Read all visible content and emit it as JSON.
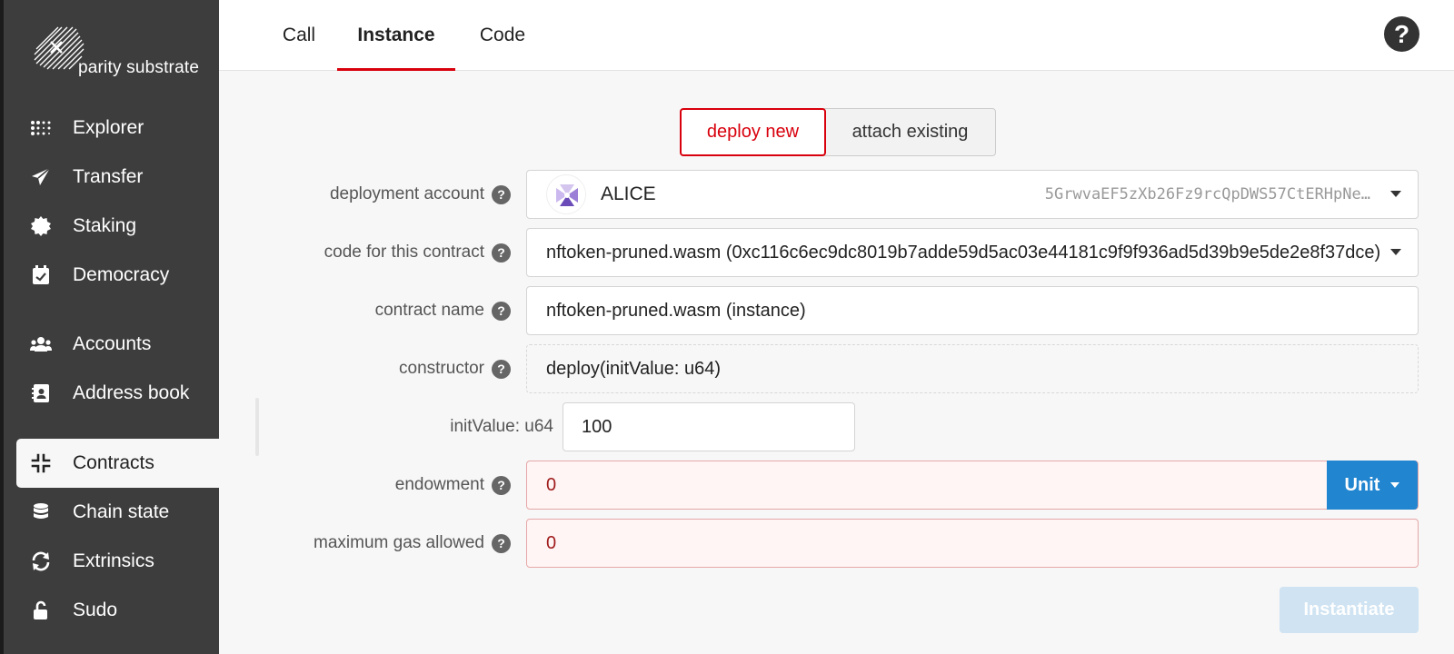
{
  "sidebar": {
    "logo_text": "parity substrate",
    "items": [
      {
        "label": "Explorer",
        "icon": "explorer-dots-icon"
      },
      {
        "label": "Transfer",
        "icon": "paper-plane-icon"
      },
      {
        "label": "Staking",
        "icon": "certificate-icon"
      },
      {
        "label": "Democracy",
        "icon": "calendar-check-icon"
      },
      {
        "label": "Accounts",
        "icon": "users-icon"
      },
      {
        "label": "Address book",
        "icon": "address-book-icon"
      },
      {
        "label": "Contracts",
        "icon": "compress-icon"
      },
      {
        "label": "Chain state",
        "icon": "database-icon"
      },
      {
        "label": "Extrinsics",
        "icon": "sync-icon"
      },
      {
        "label": "Sudo",
        "icon": "unlock-icon"
      }
    ],
    "active": "Contracts"
  },
  "tabs": [
    {
      "label": "Call"
    },
    {
      "label": "Instance"
    },
    {
      "label": "Code"
    }
  ],
  "active_tab": "Instance",
  "mode_toggle": {
    "deploy_new": "deploy new",
    "attach_existing": "attach existing",
    "selected": "deploy new"
  },
  "form": {
    "deployment_account": {
      "label": "deployment account",
      "name": "ALICE",
      "address": "5GrwvaEF5zXb26Fz9rcQpDWS57CtERHpNe…"
    },
    "code": {
      "label": "code for this contract",
      "value": "nftoken-pruned.wasm (0xc116c6ec9dc8019b7adde59d5ac03e44181c9f9f936ad5d39b9e5de2e8f37dce)"
    },
    "contract_name": {
      "label": "contract name",
      "value": "nftoken-pruned.wasm (instance)"
    },
    "constructor": {
      "label": "constructor",
      "value": "deploy(initValue: u64)"
    },
    "init_value": {
      "label": "initValue: u64",
      "value": "100"
    },
    "endowment": {
      "label": "endowment",
      "value": "0",
      "unit_label": "Unit"
    },
    "max_gas": {
      "label": "maximum gas allowed",
      "value": "0"
    }
  },
  "instantiate_label": "Instantiate",
  "help_glyph": "?",
  "colors": {
    "sidebar_bg": "#3d3d3d",
    "accent_red": "#d8000c",
    "primary_blue": "#2185d0",
    "error_bg": "#fff5f5"
  }
}
